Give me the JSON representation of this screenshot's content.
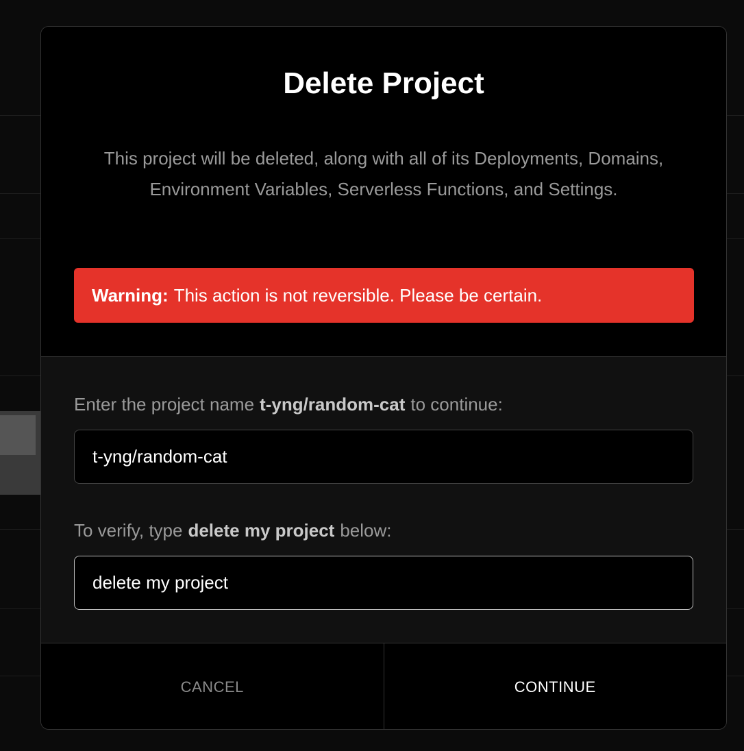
{
  "modal": {
    "title": "Delete Project",
    "description": "This project will be deleted, along with all of its Deployments, Domains, Environment Variables, Serverless Functions, and Settings.",
    "warning": {
      "label": "Warning:",
      "text": "This action is not reversible. Please be certain."
    },
    "project_name_prompt": {
      "before": "Enter the project name",
      "name": "t-yng/random-cat",
      "after": "to continue:"
    },
    "project_name_value": "t-yng/random-cat",
    "verify_prompt": {
      "before": "To verify, type",
      "phrase": "delete my project",
      "after": "below:"
    },
    "verify_value": "delete my project",
    "cancel_label": "CANCEL",
    "continue_label": "CONTINUE"
  },
  "colors": {
    "warning_bg": "#e5332a",
    "modal_bg": "#000000",
    "body_bg": "#111111"
  }
}
